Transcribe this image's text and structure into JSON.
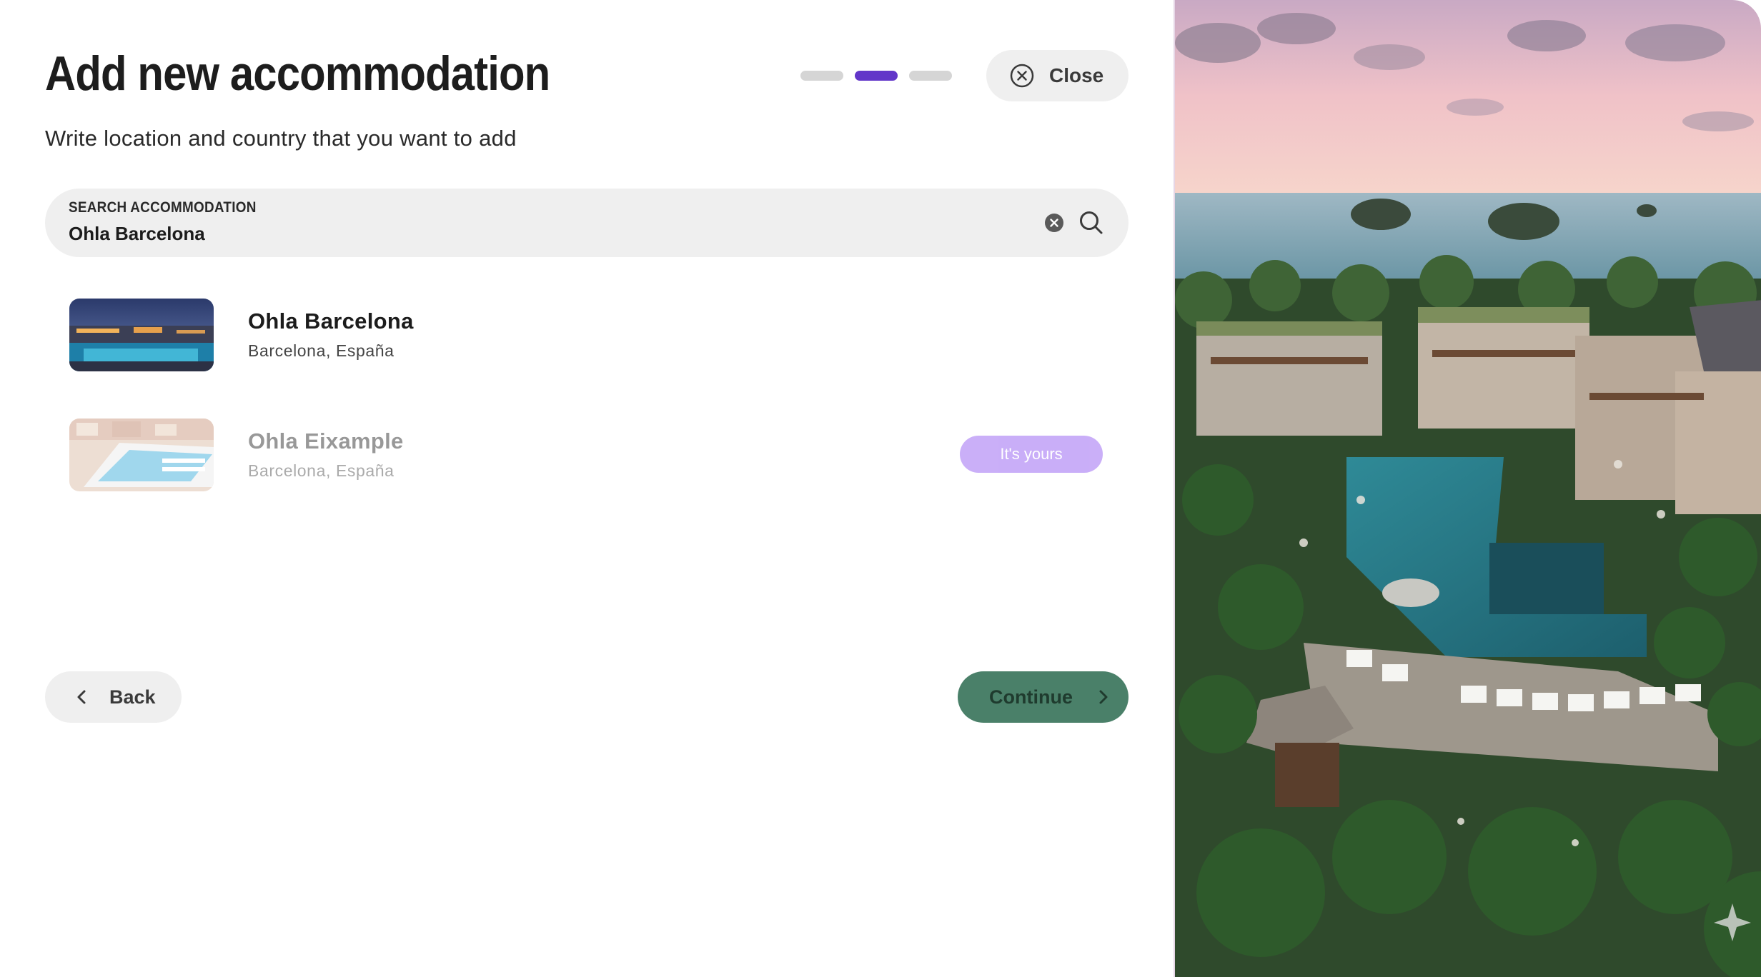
{
  "header": {
    "title": "Add new accommodation",
    "subtitle": "Write location and country that you want to add",
    "close_label": "Close"
  },
  "stepper": {
    "total_steps": 3,
    "current_step": 2,
    "active_color": "#6236c9"
  },
  "search": {
    "label": "SEARCH ACCOMMODATION",
    "value": "Ohla Barcelona"
  },
  "results": [
    {
      "name": "Ohla Barcelona",
      "location": "Barcelona, España",
      "disabled": false
    },
    {
      "name": "Ohla Eixample",
      "location": "Barcelona, España",
      "disabled": true,
      "badge": "It's yours"
    }
  ],
  "footer": {
    "back_label": "Back",
    "continue_label": "Continue"
  },
  "colors": {
    "accent": "#6236c9",
    "badge": "#8a4df0",
    "continue": "#4a8069"
  }
}
